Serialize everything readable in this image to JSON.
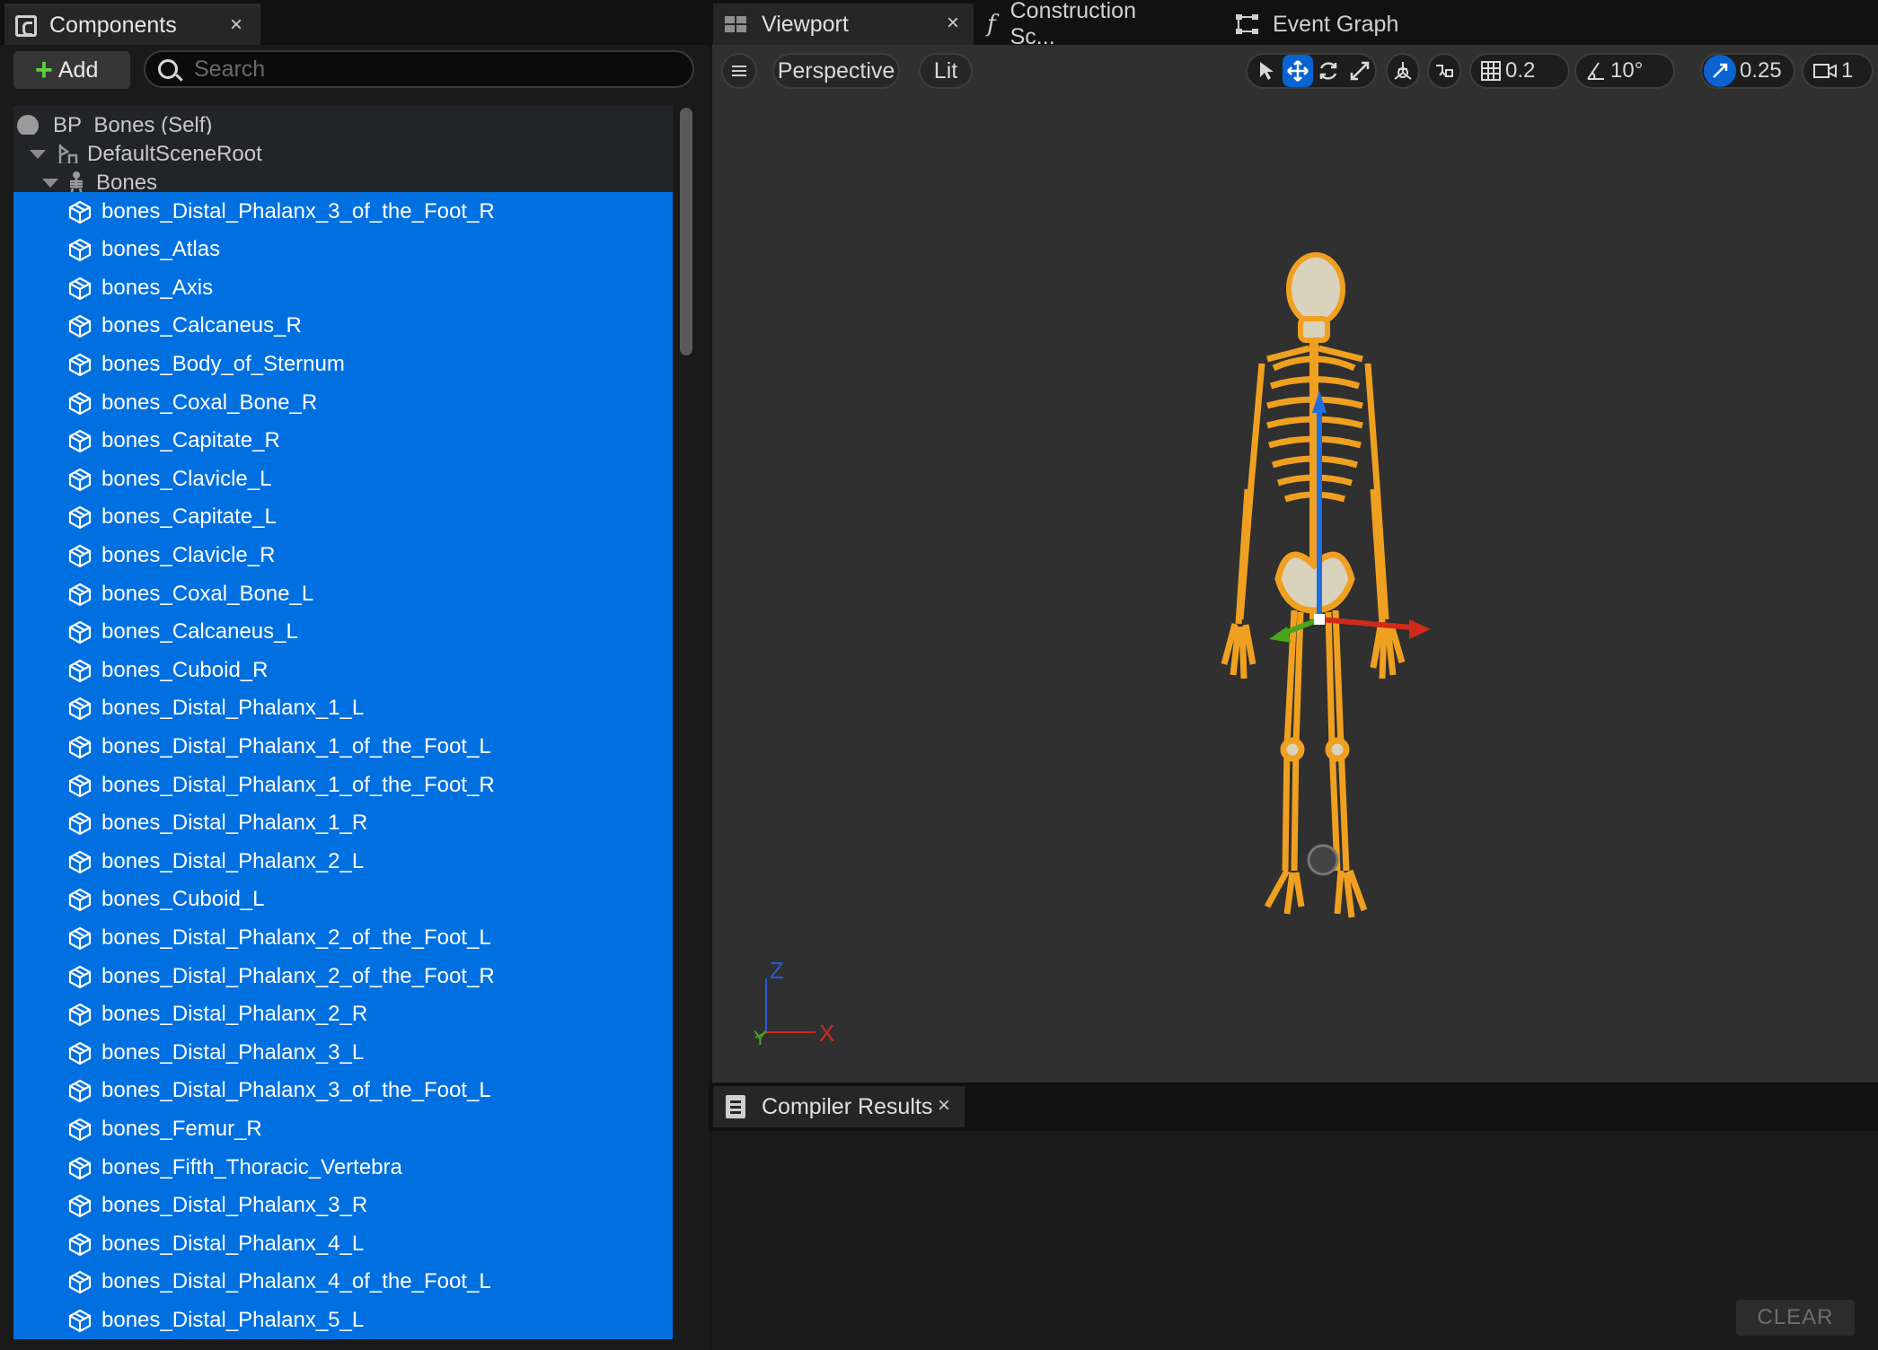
{
  "components_panel": {
    "tab_title": "Components",
    "tab_close": "×",
    "add_label": "Add",
    "search_placeholder": "Search",
    "root_item": "BP_Bones (Self)",
    "scene_root": "DefaultSceneRoot",
    "bones_node": "Bones",
    "children": [
      "bones_Distal_Phalanx_3_of_the_Foot_R",
      "bones_Atlas",
      "bones_Axis",
      "bones_Calcaneus_R",
      "bones_Body_of_Sternum",
      "bones_Coxal_Bone_R",
      "bones_Capitate_R",
      "bones_Clavicle_L",
      "bones_Capitate_L",
      "bones_Clavicle_R",
      "bones_Coxal_Bone_L",
      "bones_Calcaneus_L",
      "bones_Cuboid_R",
      "bones_Distal_Phalanx_1_L",
      "bones_Distal_Phalanx_1_of_the_Foot_L",
      "bones_Distal_Phalanx_1_of_the_Foot_R",
      "bones_Distal_Phalanx_1_R",
      "bones_Distal_Phalanx_2_L",
      "bones_Cuboid_L",
      "bones_Distal_Phalanx_2_of_the_Foot_L",
      "bones_Distal_Phalanx_2_of_the_Foot_R",
      "bones_Distal_Phalanx_2_R",
      "bones_Distal_Phalanx_3_L",
      "bones_Distal_Phalanx_3_of_the_Foot_L",
      "bones_Femur_R",
      "bones_Fifth_Thoracic_Vertebra",
      "bones_Distal_Phalanx_3_R",
      "bones_Distal_Phalanx_4_L",
      "bones_Distal_Phalanx_4_of_the_Foot_L",
      "bones_Distal_Phalanx_5_L"
    ],
    "selection_color": "#0070e0"
  },
  "editor_tabs": {
    "viewport": "Viewport",
    "viewport_close": "×",
    "construction_script": "Construction Sc...",
    "event_graph": "Event Graph"
  },
  "viewport_toolbar": {
    "menu_icon": "hamburger-icon",
    "perspective": "Perspective",
    "lit": "Lit",
    "grid_snap": "0.2",
    "rotation_snap": "10°",
    "scale_snap": "0.25",
    "camera_speed": "1",
    "active_tool": "translate",
    "accent": "#0a63d1"
  },
  "axis_indicator": {
    "z": "Z",
    "y": "Y",
    "x": "X"
  },
  "compiler_results": {
    "tab_title": "Compiler Results",
    "tab_close": "×",
    "clear_label": "CLEAR"
  }
}
